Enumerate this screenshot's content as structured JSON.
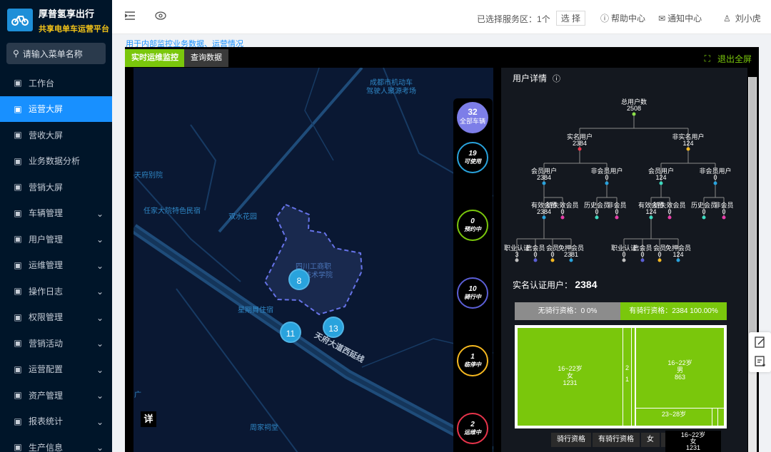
{
  "app": {
    "title": "厚普氢享出行",
    "subtitle": "共享电单车运营平台"
  },
  "search": {
    "placeholder": "请输入菜单名称"
  },
  "menu": [
    {
      "label": "工作台",
      "icon": "monitor-icon",
      "expand": false
    },
    {
      "label": "运营大屏",
      "icon": "chart-icon",
      "expand": false,
      "active": true
    },
    {
      "label": "营收大屏",
      "icon": "money-bag-icon",
      "expand": false
    },
    {
      "label": "业务数据分析",
      "icon": "report-icon",
      "expand": false
    },
    {
      "label": "营销大屏",
      "icon": "bar-chart-icon",
      "expand": false
    },
    {
      "label": "车辆管理",
      "icon": "bike-icon",
      "expand": true
    },
    {
      "label": "用户管理",
      "icon": "user-icon",
      "expand": true
    },
    {
      "label": "运维管理",
      "icon": "wrench-icon",
      "expand": true
    },
    {
      "label": "操作日志",
      "icon": "log-icon",
      "expand": true
    },
    {
      "label": "权限管理",
      "icon": "shield-icon",
      "expand": true
    },
    {
      "label": "营销活动",
      "icon": "gift-icon",
      "expand": true
    },
    {
      "label": "运营配置",
      "icon": "config-icon",
      "expand": true
    },
    {
      "label": "资产管理",
      "icon": "asset-icon",
      "expand": true
    },
    {
      "label": "报表统计",
      "icon": "pie-icon",
      "expand": true
    },
    {
      "label": "生产信息",
      "icon": "factory-icon",
      "expand": true
    }
  ],
  "topbar": {
    "region_label": "已选择服务区：",
    "region_count": "1个",
    "select_btn": "选 择",
    "help": "帮助中心",
    "notice": "通知中心",
    "user": "刘小虎"
  },
  "hint": "用于内部监控业务数据、运营情况",
  "tabs": {
    "realtime": "实时运维监控",
    "query": "查询数据",
    "exit_full": "退出全屏"
  },
  "map": {
    "labels": [
      "成都市机动车",
      "驾驶人聚源考场",
      "天府别院",
      "任家大院特色民宿",
      "双水花园",
      "四川工商职",
      "业技术学院",
      "星期舞住宿",
      "天府大道西延线",
      "周家祠堂",
      "广"
    ],
    "clusters": [
      "8",
      "11",
      "13"
    ],
    "detail_btn": "详"
  },
  "stats": {
    "total": "32",
    "total_label": "全部车辆",
    "items": [
      {
        "n": "19",
        "l": "可使用",
        "color": "#29a3dd"
      },
      {
        "n": "0",
        "l": "预约中",
        "color": "#7ac70c"
      },
      {
        "n": "10",
        "l": "骑行中",
        "color": "#5b5fd6"
      },
      {
        "n": "1",
        "l": "临停中",
        "color": "#f5b820"
      },
      {
        "n": "2",
        "l": "运维中",
        "color": "#e8344b"
      }
    ]
  },
  "user_detail": {
    "title": "用户详情",
    "tree": {
      "root": {
        "l": "总用户数",
        "v": "2508"
      },
      "l1": [
        {
          "l": "实名用户",
          "v": "2384"
        },
        {
          "l": "非实名用户",
          "v": "124"
        }
      ],
      "l2": [
        {
          "l": "会员用户",
          "v": "2384"
        },
        {
          "l": "非会员用户",
          "v": "0"
        },
        {
          "l": "会员用户",
          "v": "124"
        },
        {
          "l": "非会员用户",
          "v": "0"
        }
      ],
      "l3": [
        {
          "l": "有效会员",
          "v": "2384"
        },
        {
          "l": "待失效会员",
          "v": "0"
        },
        {
          "l": "历史会员",
          "v": "0"
        },
        {
          "l": "非会员",
          "v": "0"
        },
        {
          "l": "有效会员",
          "v": "124"
        },
        {
          "l": "待失效会员",
          "v": "0"
        },
        {
          "l": "历史会员",
          "v": "0"
        },
        {
          "l": "非会员",
          "v": "0"
        }
      ],
      "l4": [
        {
          "l": "职业认证",
          "v": "3"
        },
        {
          "l": "信会员",
          "v": "0"
        },
        {
          "l": "会员",
          "v": "0"
        },
        {
          "l": "免押会员",
          "v": "2381"
        },
        {
          "l": "职业认证",
          "v": "0"
        },
        {
          "l": "信会员",
          "v": "0"
        },
        {
          "l": "会员",
          "v": "0"
        },
        {
          "l": "免押会员",
          "v": "124"
        }
      ]
    },
    "realname_label": "实名认证用户：",
    "realname_count": "2384",
    "bar": {
      "no": "无骑行资格：0  0%",
      "yes": "有骑行资格：2384  100.00%"
    },
    "treemap": [
      {
        "t": "16~22岁",
        "s": "女",
        "v": "1231"
      },
      {
        "t": "2",
        "s": "1",
        "v": ""
      },
      {
        "t": "16~22岁",
        "s": "男",
        "v": "863"
      },
      {
        "t": "23~28岁",
        "s": "",
        "v": ""
      }
    ],
    "breadcrumb": [
      "骑行资格",
      "有骑行资格",
      "女",
      "16~22岁"
    ],
    "tooltip": {
      "t": "16~22岁",
      "s": "女",
      "v": "1231"
    },
    "colors": {
      "green": "#7ac70c",
      "panel": "#14181f",
      "grey": "#8c8c8c"
    }
  }
}
